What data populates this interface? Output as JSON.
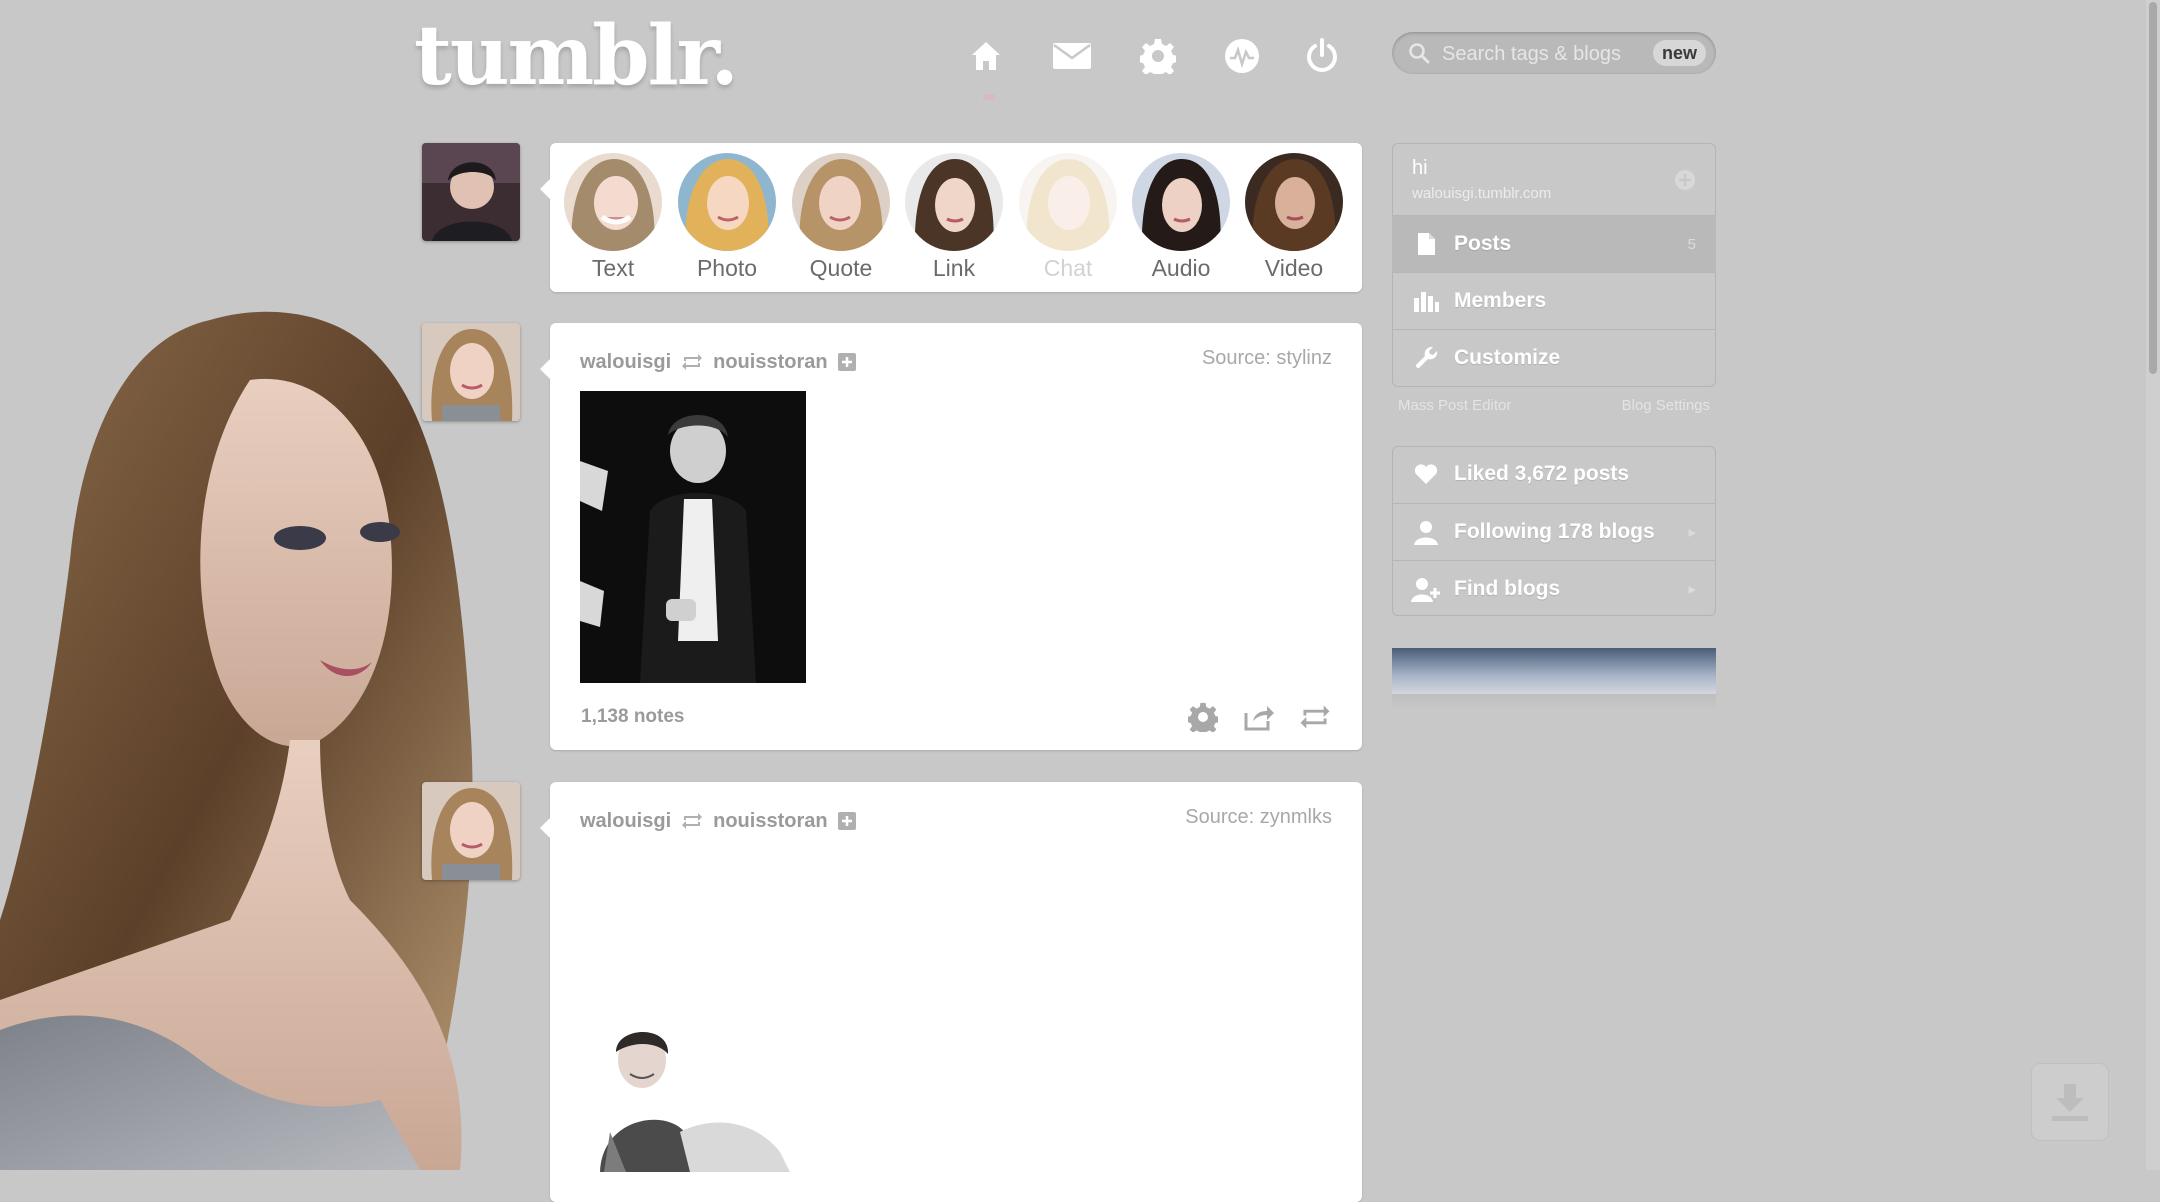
{
  "header": {
    "logo": "tumblr.",
    "nav": [
      {
        "icon": "home-icon"
      },
      {
        "icon": "mail-icon"
      },
      {
        "icon": "gear-icon"
      },
      {
        "icon": "activity-icon"
      },
      {
        "icon": "power-icon"
      }
    ],
    "search": {
      "placeholder": "Search tags & blogs",
      "badge": "new"
    }
  },
  "composer": {
    "types": [
      {
        "label": "Text"
      },
      {
        "label": "Photo"
      },
      {
        "label": "Quote"
      },
      {
        "label": "Link"
      },
      {
        "label": "Chat"
      },
      {
        "label": "Audio"
      },
      {
        "label": "Video"
      }
    ]
  },
  "posts": [
    {
      "author": "walouisgi",
      "reblogged_from": "nouisstoran",
      "source": "Source: stylinz",
      "notes": "1,138 notes"
    },
    {
      "author": "walouisgi",
      "reblogged_from": "nouisstoran",
      "source": "Source: zynmlks"
    }
  ],
  "sidebar": {
    "blog": {
      "name": "hi",
      "url": "walouisgi.tumblr.com"
    },
    "menu": [
      {
        "label": "Posts",
        "count": "5"
      },
      {
        "label": "Members"
      },
      {
        "label": "Customize"
      }
    ],
    "links": {
      "mass_editor": "Mass Post Editor",
      "settings": "Blog Settings"
    },
    "activity": [
      {
        "label": "Liked 3,672 posts"
      },
      {
        "label": "Following 178 blogs"
      },
      {
        "label": "Find blogs"
      }
    ]
  },
  "colors": {
    "background": "#c8c8c8",
    "card": "#ffffff",
    "accent": "#2c3e50"
  }
}
